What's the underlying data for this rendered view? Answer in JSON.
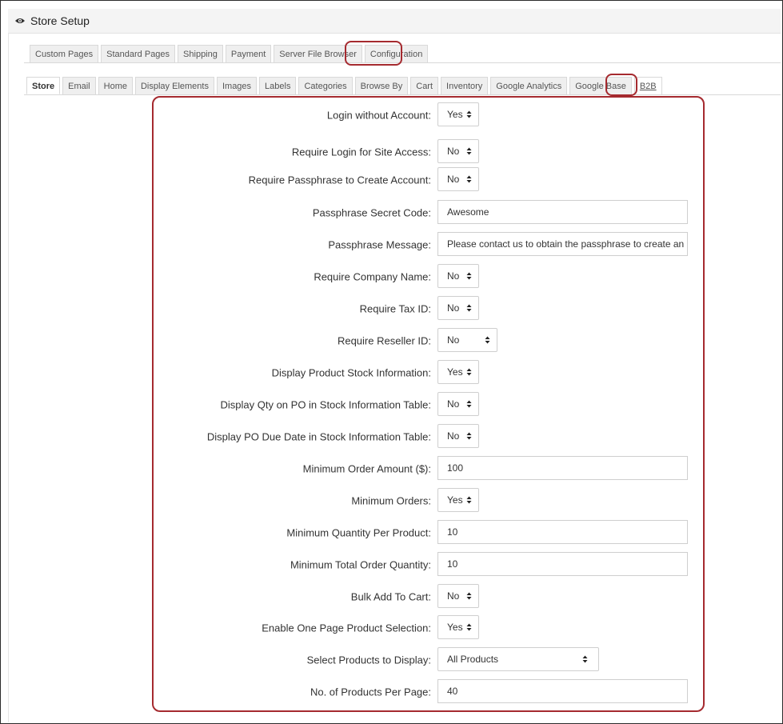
{
  "header": {
    "title": "Store Setup"
  },
  "main_tabs": [
    {
      "label": "Custom Pages"
    },
    {
      "label": "Standard Pages"
    },
    {
      "label": "Shipping"
    },
    {
      "label": "Payment"
    },
    {
      "label": "Server File Browser"
    },
    {
      "label": "Configuration"
    }
  ],
  "sub_tabs": [
    {
      "label": "Store"
    },
    {
      "label": "Email"
    },
    {
      "label": "Home"
    },
    {
      "label": "Display Elements"
    },
    {
      "label": "Images"
    },
    {
      "label": "Labels"
    },
    {
      "label": "Categories"
    },
    {
      "label": "Browse By"
    },
    {
      "label": "Cart"
    },
    {
      "label": "Inventory"
    },
    {
      "label": "Google Analytics"
    },
    {
      "label": "Google Base"
    },
    {
      "label": "B2B"
    }
  ],
  "form": {
    "login_without_account": {
      "label": "Login without Account:",
      "value": "Yes"
    },
    "require_login": {
      "label": "Require Login for Site Access:",
      "value": "No"
    },
    "require_passphrase": {
      "label": "Require Passphrase to Create Account:",
      "value": "No"
    },
    "passphrase_code": {
      "label": "Passphrase Secret Code:",
      "value": "Awesome"
    },
    "passphrase_message": {
      "label": "Passphrase Message:",
      "value": "Please contact us to obtain the passphrase to create an"
    },
    "require_company": {
      "label": "Require Company Name:",
      "value": "No"
    },
    "require_tax_id": {
      "label": "Require Tax ID:",
      "value": "No"
    },
    "require_reseller_id": {
      "label": "Require Reseller ID:",
      "value": "No"
    },
    "display_stock_info": {
      "label": "Display Product Stock Information:",
      "value": "Yes"
    },
    "display_qty_po": {
      "label": "Display Qty on PO in Stock Information Table:",
      "value": "No"
    },
    "display_po_due": {
      "label": "Display PO Due Date in Stock Information Table:",
      "value": "No"
    },
    "min_order_amount": {
      "label": "Minimum Order Amount ($):",
      "value": "100"
    },
    "min_orders": {
      "label": "Minimum Orders:",
      "value": "Yes"
    },
    "min_qty_per_product": {
      "label": "Minimum Quantity Per Product:",
      "value": "10"
    },
    "min_total_qty": {
      "label": "Minimum Total Order Quantity:",
      "value": "10"
    },
    "bulk_add": {
      "label": "Bulk Add To Cart:",
      "value": "No"
    },
    "one_page_selection": {
      "label": "Enable One Page Product Selection:",
      "value": "Yes"
    },
    "select_products": {
      "label": "Select Products to Display:",
      "value": "All Products"
    },
    "products_per_page": {
      "label": "No. of Products Per Page:",
      "value": "40"
    }
  },
  "colors": {
    "highlight": "#a52a2f",
    "tab_bg": "#efefef",
    "header_bg": "#f4f4f4"
  },
  "icons": {
    "header": "eye-icon",
    "select": "updown-arrow-icon"
  }
}
